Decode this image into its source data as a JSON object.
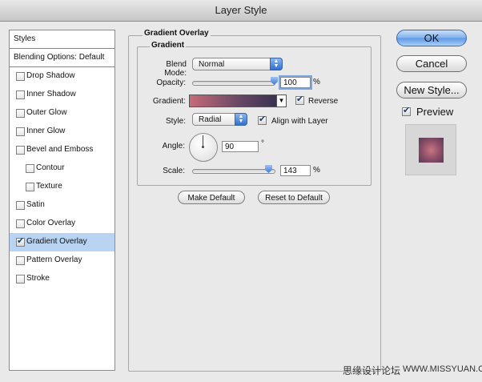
{
  "window": {
    "title": "Layer Style"
  },
  "styles_list": {
    "header": "Styles",
    "blending_options": "Blending Options: Default",
    "items": [
      {
        "label": "Drop Shadow",
        "checked": false,
        "indent": false,
        "selected": false
      },
      {
        "label": "Inner Shadow",
        "checked": false,
        "indent": false,
        "selected": false
      },
      {
        "label": "Outer Glow",
        "checked": false,
        "indent": false,
        "selected": false
      },
      {
        "label": "Inner Glow",
        "checked": false,
        "indent": false,
        "selected": false
      },
      {
        "label": "Bevel and Emboss",
        "checked": false,
        "indent": false,
        "selected": false
      },
      {
        "label": "Contour",
        "checked": false,
        "indent": true,
        "selected": false
      },
      {
        "label": "Texture",
        "checked": false,
        "indent": true,
        "selected": false
      },
      {
        "label": "Satin",
        "checked": false,
        "indent": false,
        "selected": false
      },
      {
        "label": "Color Overlay",
        "checked": false,
        "indent": false,
        "selected": false
      },
      {
        "label": "Gradient Overlay",
        "checked": true,
        "indent": false,
        "selected": true
      },
      {
        "label": "Pattern Overlay",
        "checked": false,
        "indent": false,
        "selected": false
      },
      {
        "label": "Stroke",
        "checked": false,
        "indent": false,
        "selected": false
      }
    ]
  },
  "panel": {
    "group_title": "Gradient Overlay",
    "subgroup_title": "Gradient",
    "blend_mode_label": "Blend Mode:",
    "blend_mode_value": "Normal",
    "opacity_label": "Opacity:",
    "opacity_value": "100",
    "opacity_fraction": 1.0,
    "percent": "%",
    "gradient_label": "Gradient:",
    "reverse_label": "Reverse",
    "reverse_checked": true,
    "style_label": "Style:",
    "style_value": "Radial",
    "align_label": "Align with Layer",
    "align_checked": true,
    "angle_label": "Angle:",
    "angle_value": "90",
    "degree": "°",
    "scale_label": "Scale:",
    "scale_value": "143",
    "make_default": "Make Default",
    "reset_default": "Reset to Default",
    "gradient_colors": [
      "#c66b78",
      "#6a4866",
      "#2e2c4a"
    ]
  },
  "buttons": {
    "ok": "OK",
    "cancel": "Cancel",
    "new_style": "New Style...",
    "preview_label": "Preview",
    "preview_checked": true
  },
  "footer": {
    "chinese_text": "思缘设计论坛",
    "site": "WWW.MISSYUAN.COM"
  },
  "colors": {
    "selected_row": "#b8d4f2",
    "accent_blue": "#5d98e6",
    "preview_center": "#c97581"
  }
}
